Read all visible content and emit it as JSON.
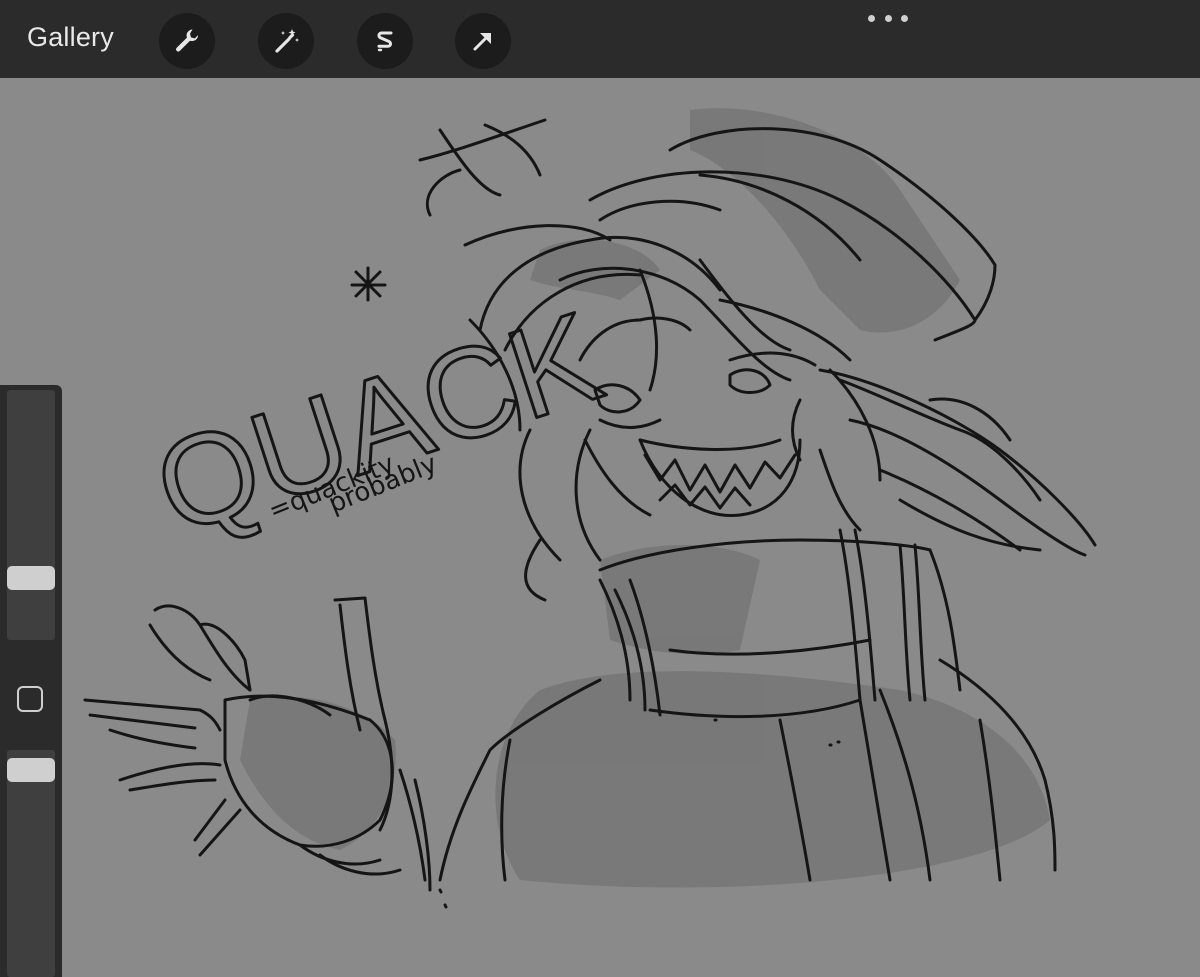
{
  "toolbar": {
    "gallery_label": "Gallery",
    "tools": [
      {
        "name": "actions",
        "icon": "wrench-icon"
      },
      {
        "name": "adjustments",
        "icon": "magic-wand-icon"
      },
      {
        "name": "selection",
        "icon": "selection-s-icon"
      },
      {
        "name": "transform",
        "icon": "arrow-cursor-icon"
      }
    ],
    "more_icon": "ellipsis-icon"
  },
  "sidebar": {
    "brush_size_level": 0.22,
    "opacity_level": 0.96,
    "modify_icon": "square-icon"
  },
  "artwork": {
    "text_main": "QUACK",
    "text_sub_1": "=quackity",
    "text_sub_2": "probably"
  },
  "colors": {
    "toolbar_bg": "#2b2b2b",
    "canvas_bg": "#8a8a8a",
    "ink": "#151515"
  }
}
